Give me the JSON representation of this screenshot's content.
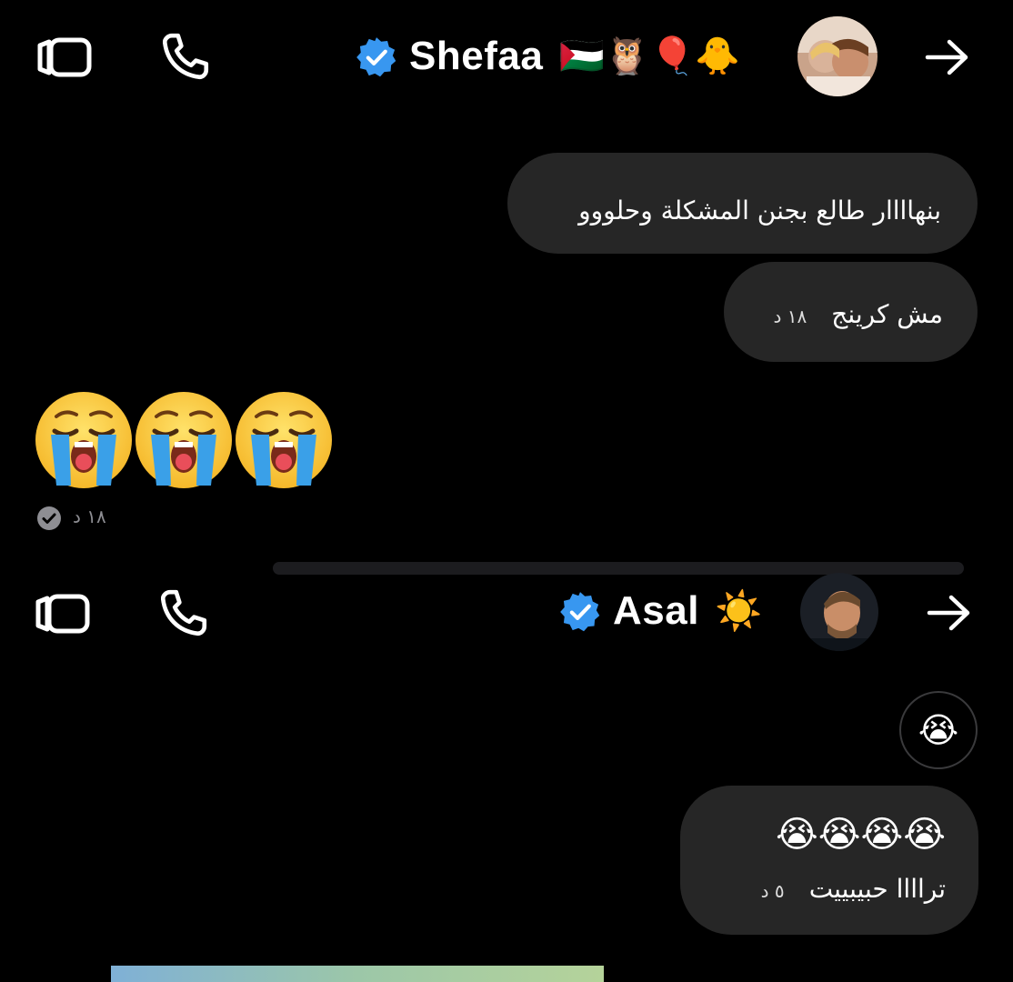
{
  "chat1": {
    "name": "Shefaa",
    "name_emojis": "🇵🇸🦉🎈🐥",
    "messages": [
      {
        "text": "بنهاااار طالع بجنن المشكلة وحلووو"
      },
      {
        "text": "مش كرينج",
        "time": "١٨ د"
      }
    ],
    "emoji_message": {
      "emoji": "😭😭😭",
      "time": "١٨ د"
    }
  },
  "chat2": {
    "name": "Asal",
    "name_emoji": "☀️",
    "reaction_emoji": "😭",
    "message": {
      "emojis": "😭😭😭😭",
      "text": "تراااا حبيبييت",
      "time": "٥ د"
    }
  },
  "colors": {
    "verified_blue": "#3897f0",
    "bubble": "#262626",
    "background": "#000000"
  },
  "icons": [
    "video-call-icon",
    "phone-icon",
    "verified-badge-icon",
    "forward-arrow-icon",
    "read-receipt-icon"
  ]
}
